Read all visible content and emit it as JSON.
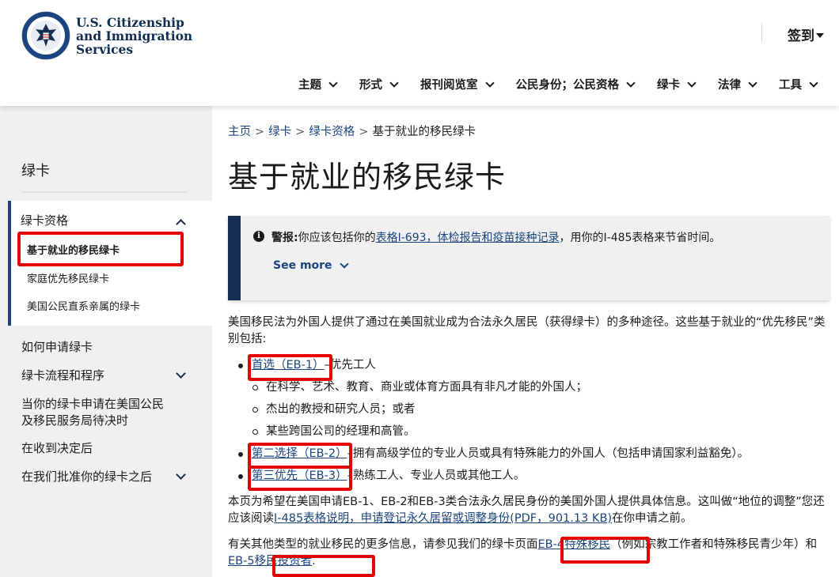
{
  "header": {
    "brand_line1": "U.S. Citizenship",
    "brand_line2": "and Immigration",
    "brand_line3": "Services",
    "signin_label": "签到",
    "nav": [
      {
        "label": "主题"
      },
      {
        "label": "形式"
      },
      {
        "label": "报刊阅览室"
      },
      {
        "label": "公民身份；公民资格"
      },
      {
        "label": "绿卡"
      },
      {
        "label": "法律"
      },
      {
        "label": "工具"
      }
    ]
  },
  "sidebar": {
    "title": "绿卡",
    "group_title": "绿卡资格",
    "sub_items": [
      {
        "label": "基于就业的移民绿卡"
      },
      {
        "label": "家庭优先移民绿卡"
      },
      {
        "label": "美国公民直系亲属的绿卡"
      }
    ],
    "items": [
      {
        "label": "如何申请绿卡"
      },
      {
        "label": "绿卡流程和程序"
      },
      {
        "label": "当你的绿卡申请在美国公民及移民服务局待决时"
      },
      {
        "label": "在收到决定后"
      },
      {
        "label": "在我们批准你的绿卡之后"
      }
    ]
  },
  "breadcrumb": {
    "home": "主页",
    "greencard": "绿卡",
    "eligibility": "绿卡资格",
    "current": "基于就业的移民绿卡",
    "sep": ">"
  },
  "page_title": "基于就业的移民绿卡",
  "alert": {
    "info_glyph": "i",
    "label": "警报:",
    "text_before": "你应该包括你的",
    "link": "表格I-693，体检报告和疫苗接种记录",
    "text_after": "，用你的I-485表格来节省时间。",
    "see_more": "See more"
  },
  "content": {
    "intro": "美国移民法为外国人提供了通过在美国就业成为合法永久居民（获得绿卡）的多种途径。这些基于就业的“优先移民”类别包括:",
    "eb1_link": "首选（EB-1）",
    "eb1_text": "优先工人",
    "eb1_sub": [
      "在科学、艺术、教育、商业或体育方面具有非凡才能的外国人；",
      "杰出的教授和研究人员；或者",
      "某些跨国公司的经理和高管。"
    ],
    "eb2_link": "第二选择（EB-2）",
    "eb2_text": "拥有高级学位的专业人员或具有特殊能力的外国人（包括申请国家利益豁免）。",
    "eb3_link": "第三优先（EB-3）",
    "eb3_text": "熟练工人、专业人员或其他工人。",
    "para2_before": "本页为希望在美国申请EB-1、EB-2和EB-3类合法永久居民身份的美国外国人提供具体信息。这叫做“地位的调整”您还应该阅读",
    "para2_link": "I-485表格说明，申请登记永久居留或调整身份(PDF，901.13 KB)",
    "para2_after": "在你申请之前。",
    "para3_before": "有关其他类型的就业移民的更多信息，请参见我们的绿卡页面",
    "para3_link1": "EB-4特殊移民",
    "para3_mid": "（例如宗教工作者和特殊移民青少年）和",
    "para3_link2": "EB-5移民投资者",
    "para3_after": "."
  },
  "colors": {
    "navy": "#162e51",
    "link": "#1a4480",
    "highlight": "#e60000",
    "sidebar_bg": "#f0f0f0"
  }
}
